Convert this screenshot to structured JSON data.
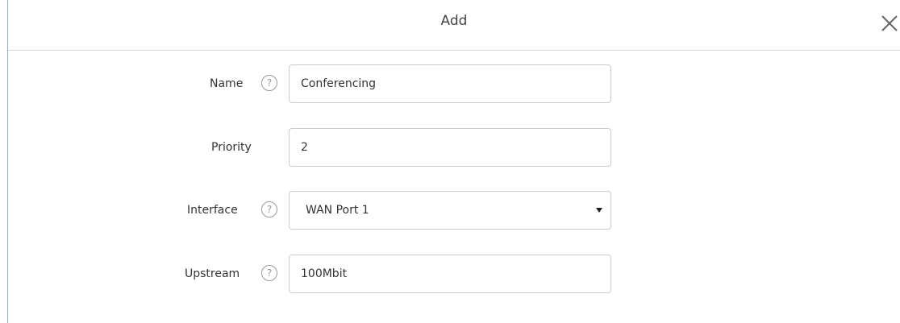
{
  "dialog": {
    "title": "Add",
    "close_icon": "close-icon"
  },
  "form": {
    "name": {
      "label": "Name",
      "value": "Conferencing",
      "help_icon": "help-icon"
    },
    "priority": {
      "label": "Priority",
      "value": "2"
    },
    "interface": {
      "label": "Interface",
      "selected": "WAN Port 1",
      "help_icon": "help-icon"
    },
    "upstream": {
      "label": "Upstream",
      "value": "100Mbit",
      "help_icon": "help-icon"
    }
  },
  "help_glyph": "?",
  "colors": {
    "border_accent": "#8fb3d6",
    "field_border": "#cccccc",
    "text": "#333333"
  }
}
